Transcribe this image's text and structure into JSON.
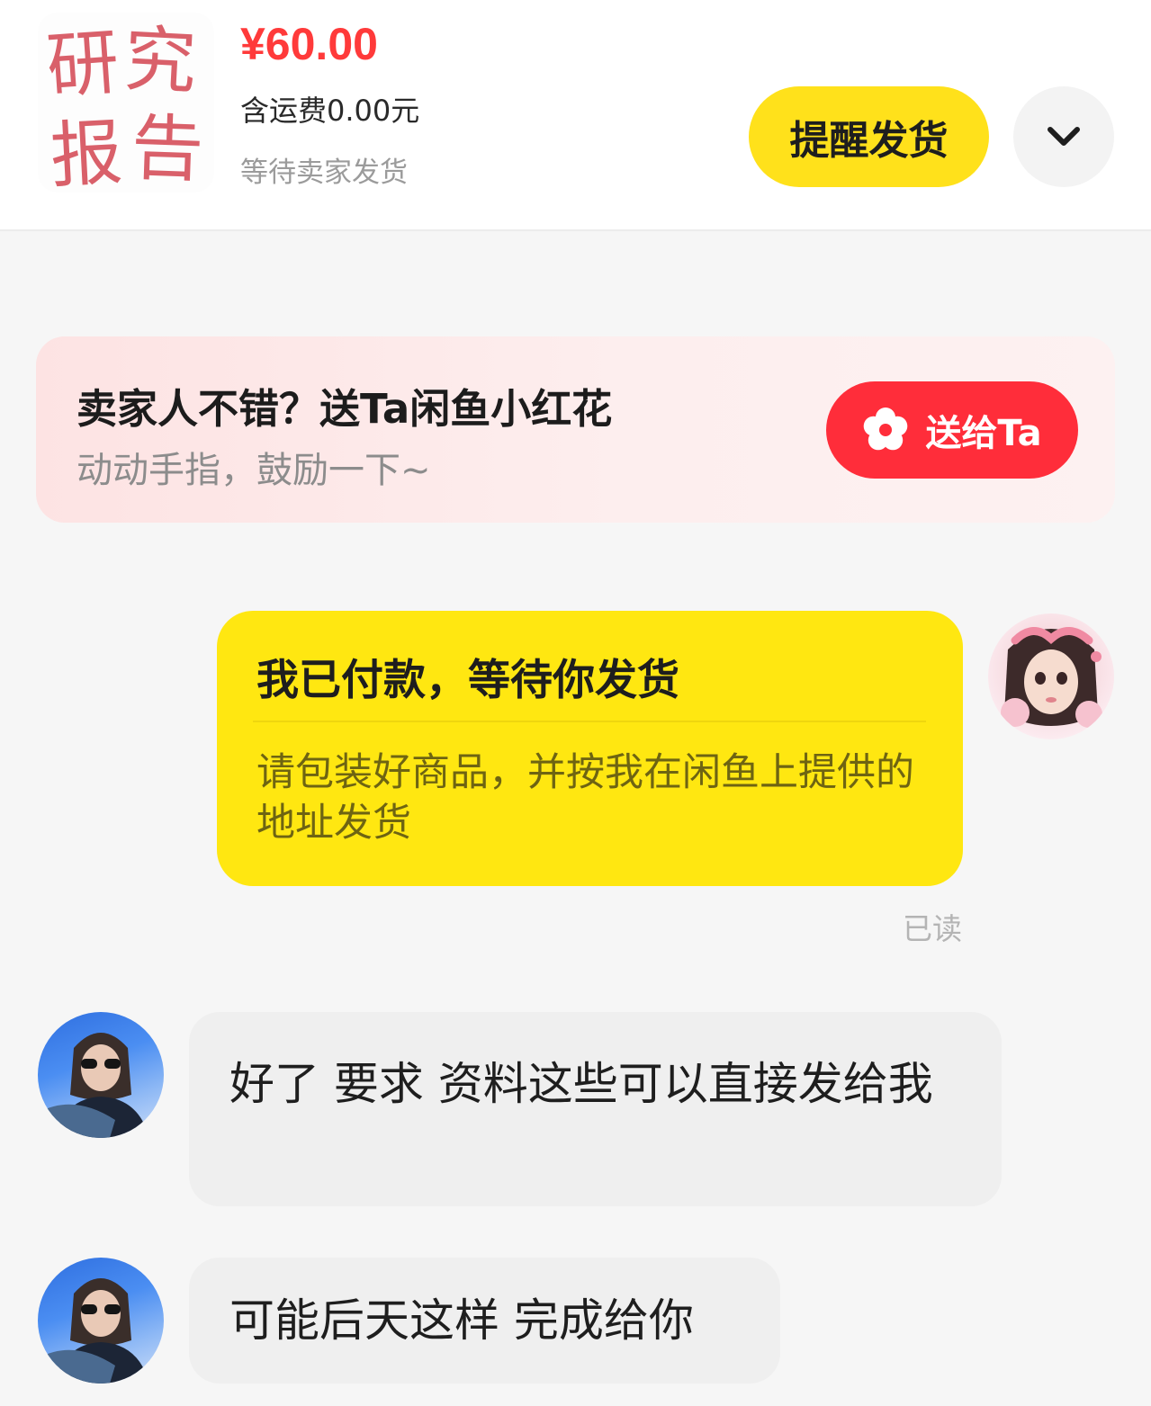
{
  "order": {
    "thumbnail_text": [
      "研",
      "究",
      "报",
      "告"
    ],
    "price": "¥60.00",
    "shipping": "含运费0.00元",
    "status": "等待卖家发货",
    "remind_label": "提醒发货",
    "expand_icon": "chevron-down-icon"
  },
  "flower_card": {
    "title": "卖家人不错？送Ta闲鱼小红花",
    "subtitle": "动动手指，鼓励一下~",
    "button_label": "送给Ta",
    "button_icon": "flower-icon",
    "button_color": "#ff2d3a"
  },
  "sent_card": {
    "title": "我已付款，等待你发货",
    "body": "请包装好商品，并按我在闲鱼上提供的地址发货",
    "read_status": "已读",
    "color": "#ffe711"
  },
  "messages": [
    {
      "text": "好了 要求 资料这些可以直接发给我"
    },
    {
      "text": "可能后天这样 完成给你"
    }
  ]
}
